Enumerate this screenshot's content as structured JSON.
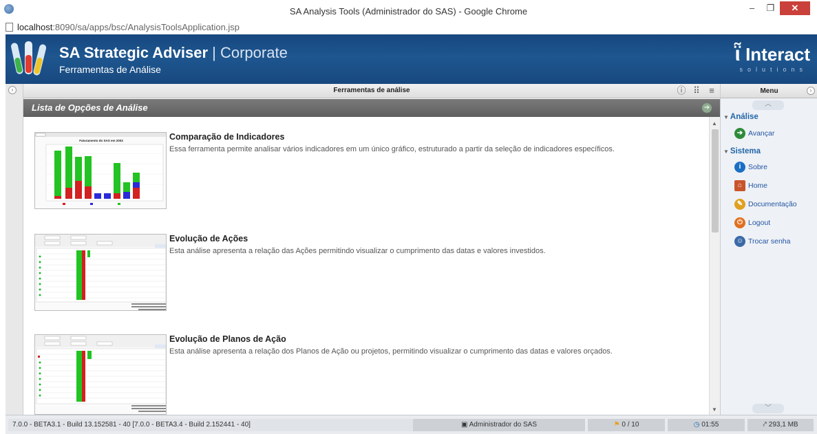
{
  "window": {
    "title": "SA Analysis Tools (Administrador do SAS) - Google Chrome",
    "url_host": "localhost",
    "url_path": ":8090/sa/apps/bsc/AnalysisToolsApplication.jsp"
  },
  "banner": {
    "product": "SA Strategic Adviser",
    "separator": " | ",
    "edition": "Corporate",
    "subtitle": "Ferramentas de Análise",
    "logo": "Interact",
    "logo_sub": "solutions"
  },
  "toolbar": {
    "title": "Ferramentas de análise"
  },
  "section": {
    "title": "Lista de Opções de Análise"
  },
  "items": [
    {
      "title": "Comparação de Indicadores",
      "description": "Essa ferramenta permite analisar vários indicadores em um único gráfico, estruturado a partir da seleção de indicadores específicos.",
      "thumb_caption": "Faturamento do SAS em 2003"
    },
    {
      "title": "Evolução de Ações",
      "description": "Esta análise apresenta a relação das Ações permitindo visualizar o cumprimento das datas e valores investidos."
    },
    {
      "title": "Evolução de Planos de Ação",
      "description": "Esta análise apresenta a relação dos Planos de Ação ou projetos, permitindo visualizar o cumprimento das datas e valores orçados."
    }
  ],
  "sidebar": {
    "menu_label": "Menu",
    "groups": [
      {
        "label": "Análise",
        "items": [
          {
            "label": "Avançar",
            "icon": "go-arrow-icon",
            "color": "#2e8b3a"
          }
        ]
      },
      {
        "label": "Sistema",
        "items": [
          {
            "label": "Sobre",
            "icon": "info-icon",
            "color": "#1a6fc4"
          },
          {
            "label": "Home",
            "icon": "home-icon",
            "color": "#c8552a"
          },
          {
            "label": "Documentação",
            "icon": "documentation-icon",
            "color": "#e0a020"
          },
          {
            "label": "Logout",
            "icon": "logout-icon",
            "color": "#e07020"
          },
          {
            "label": "Trocar senha",
            "icon": "change-password-icon",
            "color": "#3a6aa8"
          }
        ]
      }
    ]
  },
  "status": {
    "version": "7.0.0 - BETA3.1 - Build 13.152581 - 40 [7.0.0 - BETA3.4 - Build 2.152441 - 40]",
    "user": "Administrador do SAS",
    "counter": "0 / 10",
    "time": "01:55",
    "memory": "293,1 MB"
  }
}
